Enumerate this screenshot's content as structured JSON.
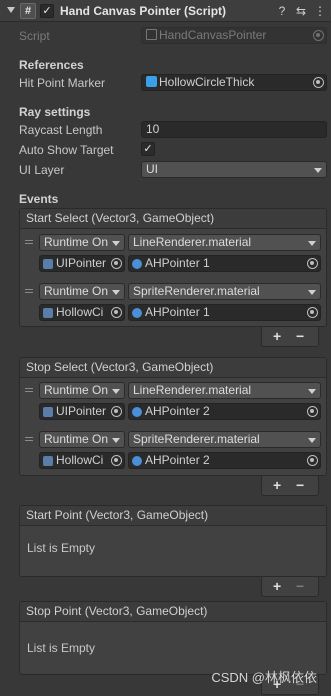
{
  "header": {
    "title": "Hand Canvas Pointer (Script)",
    "script_glyph": "#",
    "enabled_check": "✓",
    "help_glyph": "?",
    "preset_glyph": "⇆",
    "menu_glyph": "⋮"
  },
  "script": {
    "label": "Script",
    "value": "HandCanvasPointer"
  },
  "references": {
    "section": "References",
    "hit_point_label": "Hit Point Marker",
    "hit_point_value": "HollowCircleThick"
  },
  "ray": {
    "section": "Ray settings",
    "raycast_label": "Raycast Length",
    "raycast_value": "10",
    "auto_show_label": "Auto Show Target",
    "auto_show_check": "✓",
    "ui_layer_label": "UI Layer",
    "ui_layer_value": "UI"
  },
  "events": {
    "section": "Events",
    "start_select": {
      "header": "Start Select (Vector3, GameObject)",
      "rows": [
        {
          "mode": "Runtime On",
          "function": "LineRenderer.material",
          "target": "UIPointer",
          "arg": "AHPointer 1"
        },
        {
          "mode": "Runtime On",
          "function": "SpriteRenderer.material",
          "target": "HollowCi",
          "arg": "AHPointer 1"
        }
      ]
    },
    "stop_select": {
      "header": "Stop Select (Vector3, GameObject)",
      "rows": [
        {
          "mode": "Runtime On",
          "function": "LineRenderer.material",
          "target": "UIPointer",
          "arg": "AHPointer 2"
        },
        {
          "mode": "Runtime On",
          "function": "SpriteRenderer.material",
          "target": "HollowCi",
          "arg": "AHPointer 2"
        }
      ]
    },
    "start_point": {
      "header": "Start Point (Vector3, GameObject)",
      "empty": "List is Empty"
    },
    "stop_point": {
      "header": "Stop Point (Vector3, GameObject)",
      "empty": "List is Empty"
    },
    "plus": "+",
    "minus": "−"
  },
  "watermark": "CSDN @林枫依依",
  "colors": {
    "background": "#383838",
    "field": "#2a2a2a",
    "dropdown": "#515151",
    "prefab_icon": "#3aa0e8",
    "sprite_icon": "#4a8fd8"
  }
}
